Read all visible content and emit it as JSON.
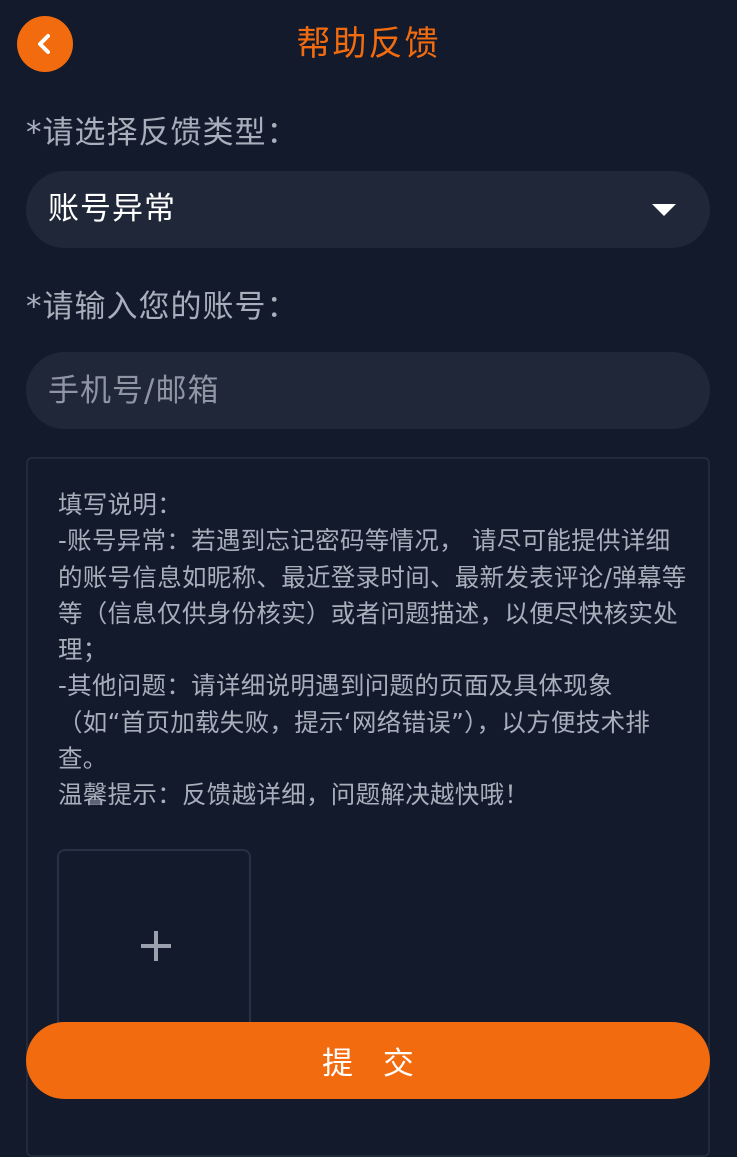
{
  "header": {
    "title": "帮助反馈",
    "back_icon": "chevron-left-icon"
  },
  "form": {
    "type_label": "*请选择反馈类型：",
    "type_value": "账号异常",
    "type_arrow_icon": "caret-down-icon",
    "account_label": "*请输入您的账号：",
    "account_placeholder": "手机号/邮箱",
    "account_value": ""
  },
  "description": {
    "text": "填写说明：\n-账号异常：若遇到忘记密码等情况， 请尽可能提供详细的账号信息如昵称、最近登录时间、最新发表评论/弹幕等等（信息仅供身份核实）或者问题描述，以便尽快核实处理；\n-其他问题：请详细说明遇到问题的页面及具体现象（如“首页加载失败，提示‘网络错误”），以方便技术排查。\n温馨提示：反馈越详细，问题解决越快哦！"
  },
  "upload": {
    "icon": "plus-icon"
  },
  "actions": {
    "submit_label": "提 交"
  },
  "colors": {
    "background": "#131a2c",
    "accent": "#f26b0f",
    "field_bg": "#1f2738",
    "muted_text": "#a9aebb"
  }
}
